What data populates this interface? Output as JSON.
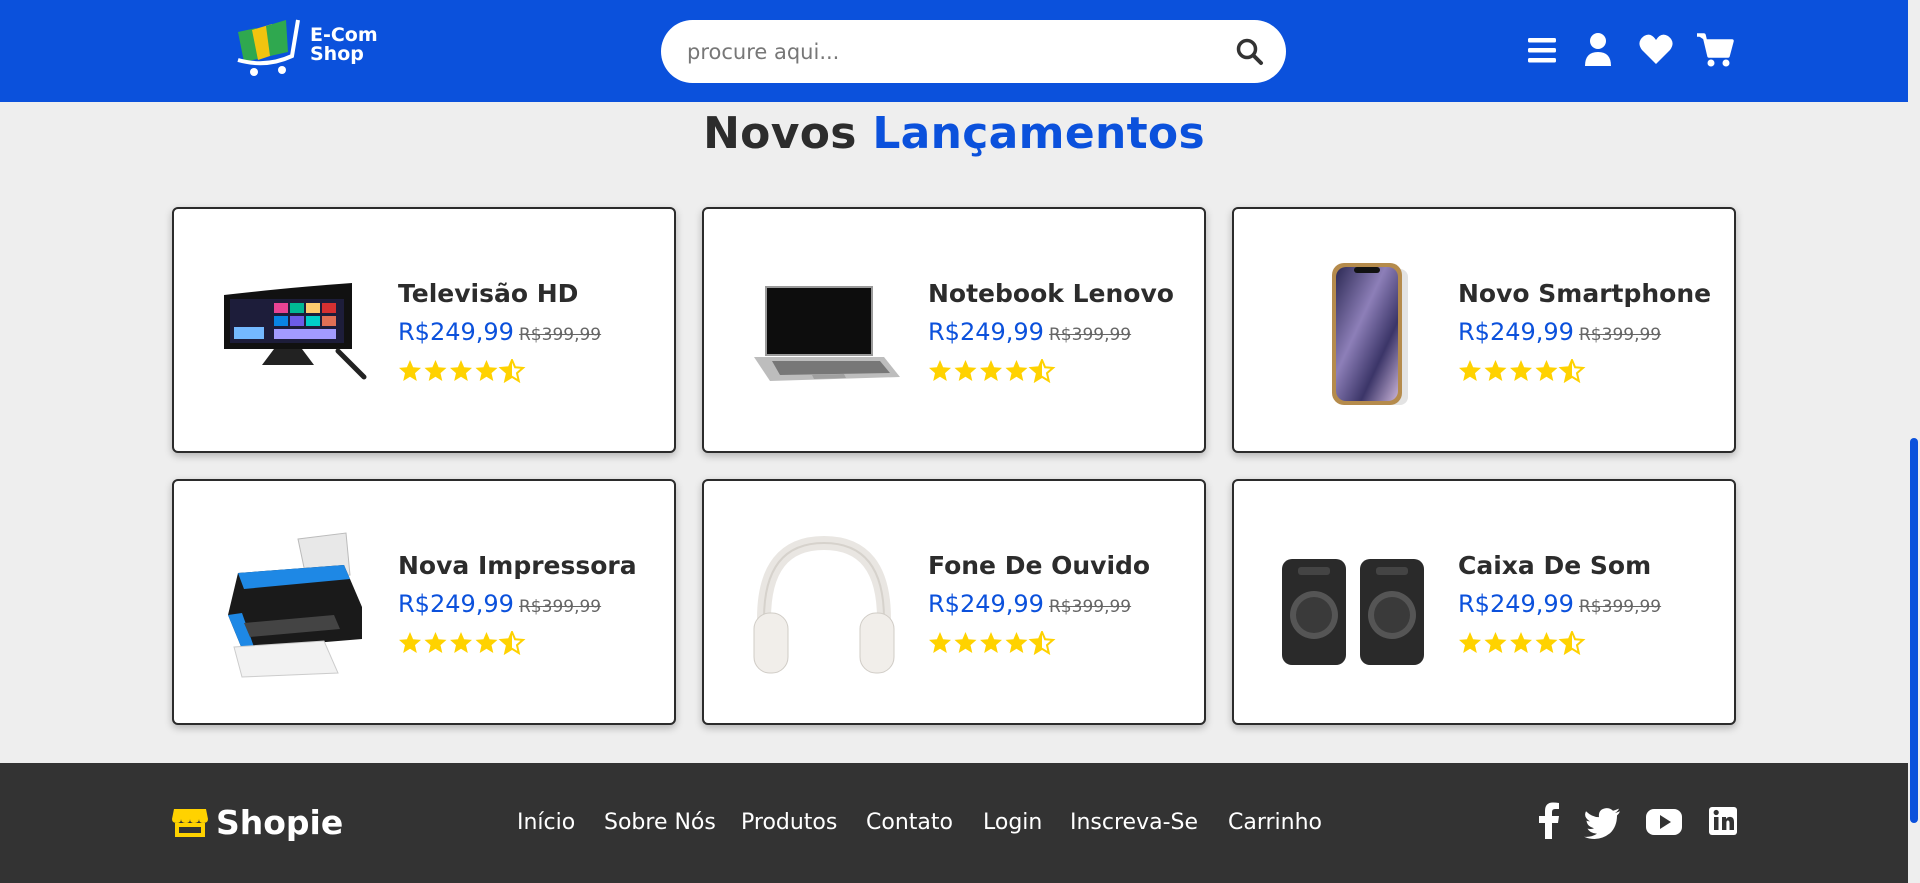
{
  "header": {
    "logo_text_line1": "E-Com",
    "logo_text_line2": "Shop",
    "search_placeholder": "procure aqui...",
    "icons": [
      "menu-icon",
      "user-icon",
      "heart-icon",
      "cart-icon"
    ]
  },
  "section": {
    "title_part1": "Novos",
    "title_part2": "Lançamentos"
  },
  "products": [
    {
      "name": "Televisão HD",
      "price": "R$249,99",
      "old_price": "R$399,99",
      "rating": 4.5,
      "image": "tv-image"
    },
    {
      "name": "Notebook Lenovo",
      "price": "R$249,99",
      "old_price": "R$399,99",
      "rating": 4.5,
      "image": "laptop-image"
    },
    {
      "name": "Novo Smartphone",
      "price": "R$249,99",
      "old_price": "R$399,99",
      "rating": 4.5,
      "image": "smartphone-image"
    },
    {
      "name": "Nova Impressora",
      "price": "R$249,99",
      "old_price": "R$399,99",
      "rating": 4.5,
      "image": "printer-image"
    },
    {
      "name": "Fone De Ouvido",
      "price": "R$249,99",
      "old_price": "R$399,99",
      "rating": 4.5,
      "image": "headphones-image"
    },
    {
      "name": "Caixa De Som",
      "price": "R$249,99",
      "old_price": "R$399,99",
      "rating": 4.5,
      "image": "speakers-image"
    }
  ],
  "footer": {
    "brand": "Shopie",
    "nav": [
      "Início",
      "Sobre Nós",
      "Produtos",
      "Contato",
      "Login",
      "Inscreva-Se",
      "Carrinho"
    ],
    "social": [
      "facebook-icon",
      "twitter-icon",
      "youtube-icon",
      "linkedin-icon"
    ]
  },
  "colors": {
    "primary": "#0b51dc",
    "star": "#ffd200",
    "footer_bg": "#333333",
    "page_bg": "#eeeeee"
  }
}
